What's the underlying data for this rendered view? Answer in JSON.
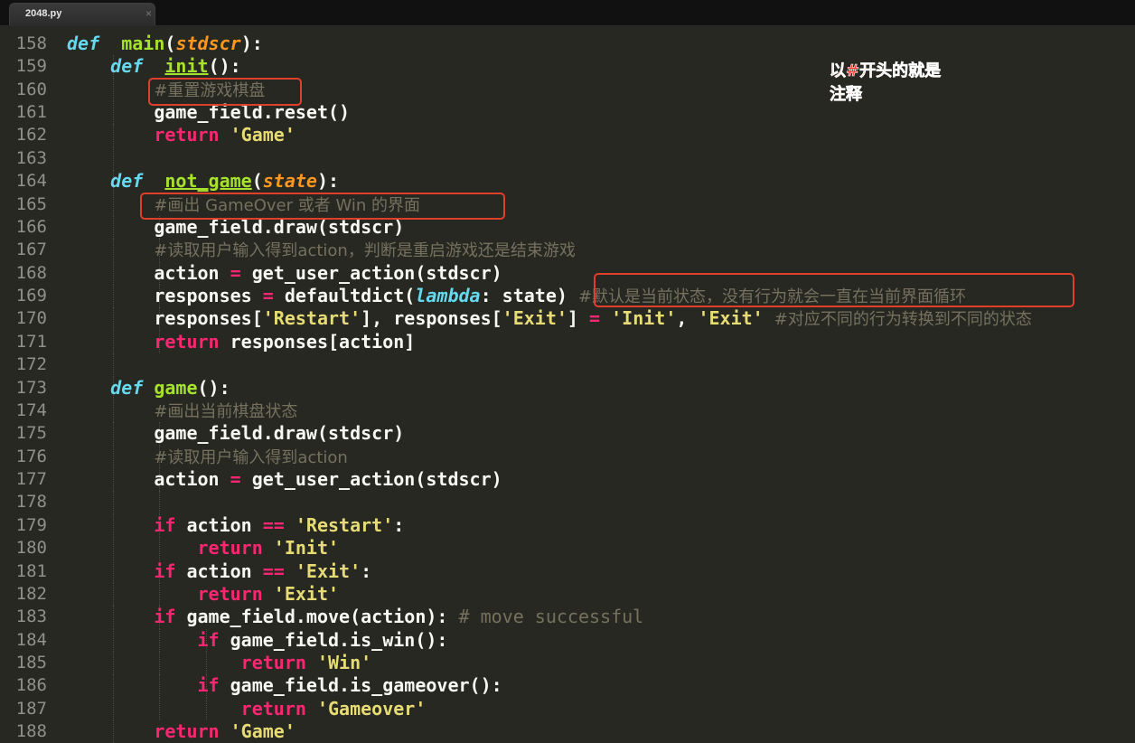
{
  "tab": {
    "title": "2048.py",
    "close": "×"
  },
  "annotation": {
    "line1": "以#开头的就是",
    "line2": "注释"
  },
  "lines": [
    {
      "n": "158",
      "parts": [
        [
          "kw-def",
          "def"
        ],
        [
          "",
          "  "
        ],
        [
          "fn-plain",
          "main"
        ],
        [
          "",
          "("
        ],
        [
          "param",
          "stdscr"
        ],
        [
          "",
          "):"
        ]
      ]
    },
    {
      "n": "159",
      "parts": [
        [
          "",
          "    "
        ],
        [
          "kw-def",
          "def"
        ],
        [
          "",
          "  "
        ],
        [
          "fn",
          "init"
        ],
        [
          "",
          "():"
        ]
      ]
    },
    {
      "n": "160",
      "parts": [
        [
          "",
          "        "
        ],
        [
          "cmt-cn",
          "#重置游戏棋盘"
        ]
      ]
    },
    {
      "n": "161",
      "parts": [
        [
          "",
          "        game_field.reset()"
        ]
      ]
    },
    {
      "n": "162",
      "parts": [
        [
          "",
          "        "
        ],
        [
          "kw",
          "return"
        ],
        [
          "",
          " "
        ],
        [
          "str",
          "'Game'"
        ]
      ]
    },
    {
      "n": "163",
      "parts": []
    },
    {
      "n": "164",
      "parts": [
        [
          "",
          "    "
        ],
        [
          "kw-def",
          "def"
        ],
        [
          "",
          "  "
        ],
        [
          "fn",
          "not_game"
        ],
        [
          "",
          "("
        ],
        [
          "param",
          "state"
        ],
        [
          "",
          "):"
        ]
      ]
    },
    {
      "n": "165",
      "parts": [
        [
          "",
          "        "
        ],
        [
          "cmt-cn",
          "#画出 GameOver 或者 Win 的界面"
        ]
      ]
    },
    {
      "n": "166",
      "parts": [
        [
          "",
          "        game_field.draw(stdscr)"
        ]
      ]
    },
    {
      "n": "167",
      "parts": [
        [
          "",
          "        "
        ],
        [
          "cmt-cn",
          "#读取用户输入得到action，判断是重启游戏还是结束游戏"
        ]
      ]
    },
    {
      "n": "168",
      "parts": [
        [
          "",
          "        action "
        ],
        [
          "kw",
          "="
        ],
        [
          "",
          " get_user_action(stdscr)"
        ]
      ]
    },
    {
      "n": "169",
      "parts": [
        [
          "",
          "        responses "
        ],
        [
          "kw",
          "="
        ],
        [
          "",
          " defaultdict("
        ],
        [
          "lam",
          "lambda"
        ],
        [
          "",
          ": state) "
        ],
        [
          "cmt-cn",
          "#默认是当前状态，没有行为就会一直在当前界面循环"
        ]
      ]
    },
    {
      "n": "170",
      "parts": [
        [
          "",
          "        responses["
        ],
        [
          "str",
          "'Restart'"
        ],
        [
          "",
          "], responses["
        ],
        [
          "str",
          "'Exit'"
        ],
        [
          "",
          "] "
        ],
        [
          "kw",
          "="
        ],
        [
          "",
          " "
        ],
        [
          "str",
          "'Init'"
        ],
        [
          "",
          ", "
        ],
        [
          "str",
          "'Exit'"
        ],
        [
          "",
          " "
        ],
        [
          "cmt-cn",
          "#对应不同的行为转换到不同的状态"
        ]
      ]
    },
    {
      "n": "171",
      "parts": [
        [
          "",
          "        "
        ],
        [
          "kw",
          "return"
        ],
        [
          "",
          " responses[action]"
        ]
      ]
    },
    {
      "n": "172",
      "parts": []
    },
    {
      "n": "173",
      "parts": [
        [
          "",
          "    "
        ],
        [
          "kw-def",
          "def"
        ],
        [
          "",
          " "
        ],
        [
          "fn-plain",
          "game"
        ],
        [
          "",
          "():"
        ]
      ]
    },
    {
      "n": "174",
      "parts": [
        [
          "",
          "        "
        ],
        [
          "cmt-cn",
          "#画出当前棋盘状态"
        ]
      ]
    },
    {
      "n": "175",
      "parts": [
        [
          "",
          "        game_field.draw(stdscr)"
        ]
      ]
    },
    {
      "n": "176",
      "parts": [
        [
          "",
          "        "
        ],
        [
          "cmt-cn",
          "#读取用户输入得到action"
        ]
      ]
    },
    {
      "n": "177",
      "parts": [
        [
          "",
          "        action "
        ],
        [
          "kw",
          "="
        ],
        [
          "",
          " get_user_action(stdscr)"
        ]
      ]
    },
    {
      "n": "178",
      "parts": []
    },
    {
      "n": "179",
      "parts": [
        [
          "",
          "        "
        ],
        [
          "kw",
          "if"
        ],
        [
          "",
          " action "
        ],
        [
          "kw",
          "=="
        ],
        [
          "",
          " "
        ],
        [
          "str",
          "'Restart'"
        ],
        [
          "",
          ":"
        ]
      ]
    },
    {
      "n": "180",
      "parts": [
        [
          "",
          "            "
        ],
        [
          "kw",
          "return"
        ],
        [
          "",
          " "
        ],
        [
          "str",
          "'Init'"
        ]
      ]
    },
    {
      "n": "181",
      "parts": [
        [
          "",
          "        "
        ],
        [
          "kw",
          "if"
        ],
        [
          "",
          " action "
        ],
        [
          "kw",
          "=="
        ],
        [
          "",
          " "
        ],
        [
          "str",
          "'Exit'"
        ],
        [
          "",
          ":"
        ]
      ]
    },
    {
      "n": "182",
      "parts": [
        [
          "",
          "            "
        ],
        [
          "kw",
          "return"
        ],
        [
          "",
          " "
        ],
        [
          "str",
          "'Exit'"
        ]
      ]
    },
    {
      "n": "183",
      "parts": [
        [
          "",
          "        "
        ],
        [
          "kw",
          "if"
        ],
        [
          "",
          " game_field.move(action): "
        ],
        [
          "cmt",
          "# move successful"
        ]
      ]
    },
    {
      "n": "184",
      "parts": [
        [
          "",
          "            "
        ],
        [
          "kw",
          "if"
        ],
        [
          "",
          " game_field.is_win():"
        ]
      ]
    },
    {
      "n": "185",
      "parts": [
        [
          "",
          "                "
        ],
        [
          "kw",
          "return"
        ],
        [
          "",
          " "
        ],
        [
          "str",
          "'Win'"
        ]
      ]
    },
    {
      "n": "186",
      "parts": [
        [
          "",
          "            "
        ],
        [
          "kw",
          "if"
        ],
        [
          "",
          " game_field.is_gameover():"
        ]
      ]
    },
    {
      "n": "187",
      "parts": [
        [
          "",
          "                "
        ],
        [
          "kw",
          "return"
        ],
        [
          "",
          " "
        ],
        [
          "str",
          "'Gameover'"
        ]
      ]
    },
    {
      "n": "188",
      "parts": [
        [
          "",
          "        "
        ],
        [
          "kw",
          "return"
        ],
        [
          "",
          " "
        ],
        [
          "str",
          "'Game'"
        ]
      ]
    }
  ]
}
